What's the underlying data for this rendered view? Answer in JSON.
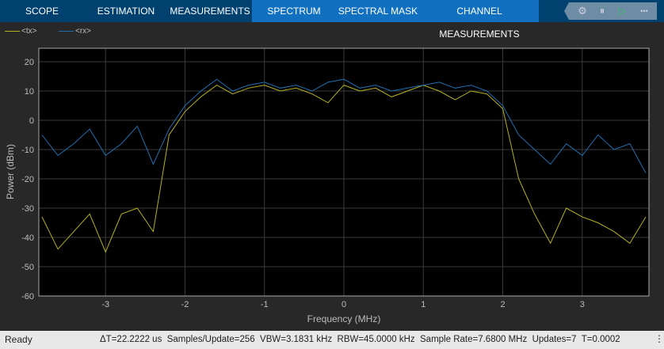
{
  "tabs": [
    "SCOPE",
    "ESTIMATION",
    "MEASUREMENTS",
    "SPECTRUM",
    "SPECTRAL MASK",
    "CHANNEL MEASUREMENTS"
  ],
  "controls": {
    "more": "•••"
  },
  "legend": [
    {
      "label": "<tx>",
      "color": "#b5b21e"
    },
    {
      "label": "<rx>",
      "color": "#1f6fb0"
    }
  ],
  "status": {
    "left": "Ready",
    "right": "ΔT=22.2222 us  Samples/Update=256  VBW=3.1831 kHz  RBW=45.0000 kHz  Sample Rate=7.6800 MHz  Updates=7  T=0.0002"
  },
  "chart_data": {
    "type": "line",
    "title": "",
    "xlabel": "Frequency (MHz)",
    "ylabel": "Power (dBm)",
    "xlim": [
      -3.84,
      3.84
    ],
    "ylim": [
      -60,
      24.6
    ],
    "xticks": [
      -3,
      -2,
      -1,
      0,
      1,
      2,
      3
    ],
    "yticks": [
      20,
      10,
      0,
      -10,
      -20,
      -30,
      -40,
      -50,
      -60
    ],
    "grid": true,
    "legend_position": "top-left",
    "x": [
      -3.8,
      -3.6,
      -3.4,
      -3.2,
      -3.0,
      -2.8,
      -2.6,
      -2.4,
      -2.2,
      -2.0,
      -1.8,
      -1.6,
      -1.4,
      -1.2,
      -1.0,
      -0.8,
      -0.6,
      -0.4,
      -0.2,
      0,
      0.2,
      0.4,
      0.6,
      0.8,
      1.0,
      1.2,
      1.4,
      1.6,
      1.8,
      2.0,
      2.2,
      2.4,
      2.6,
      2.8,
      3.0,
      3.2,
      3.4,
      3.6,
      3.8
    ],
    "series": [
      {
        "name": "<tx>",
        "color": "#b5b21e",
        "values": [
          -33,
          -44,
          -38,
          -32,
          -45,
          -32,
          -30,
          -38,
          -5,
          3,
          8,
          12,
          9,
          11,
          12,
          10,
          11,
          9,
          6,
          12,
          10,
          11,
          8,
          10,
          12,
          10,
          7,
          10,
          9,
          4,
          -20,
          -32,
          -42,
          -30,
          -33,
          -35,
          -38,
          -42,
          -33
        ]
      },
      {
        "name": "<rx>",
        "color": "#1f6fb0",
        "values": [
          -5,
          -12,
          -8,
          -3,
          -12,
          -8,
          -2,
          -15,
          -3,
          5,
          10,
          14,
          10,
          12,
          13,
          11,
          12,
          10,
          13,
          14,
          11,
          12,
          10,
          11,
          12,
          13,
          11,
          12,
          10,
          5,
          -5,
          -10,
          -15,
          -8,
          -12,
          -5,
          -10,
          -8,
          -18
        ]
      }
    ]
  }
}
